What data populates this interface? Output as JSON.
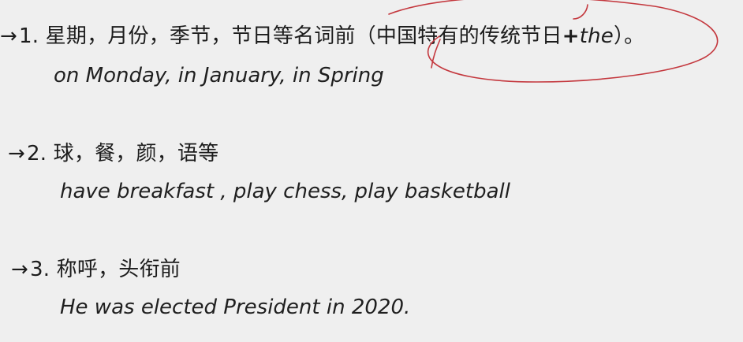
{
  "rules": [
    {
      "arrow": "→",
      "text": "1. 星期，月份，季节，节日等名词前（中国特有的传统节日",
      "plus": "+",
      "tail_em": "the",
      "end": "）。",
      "example": "on Monday, in January, in Spring"
    },
    {
      "arrow": "→",
      "text": "2. 球，餐，颜，语等",
      "example": "have breakfast , play chess, play basketball"
    },
    {
      "arrow": "→",
      "text": "3. 称呼，头衔前",
      "example": "He was elected President in 2020."
    }
  ],
  "annotation": {
    "ink_color": "#c4383e"
  }
}
